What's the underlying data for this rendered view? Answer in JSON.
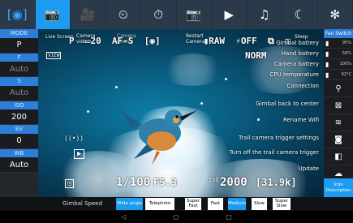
{
  "toolbar": {
    "items": [
      {
        "icon": "brackets-icon",
        "glyph": "[◉]"
      },
      {
        "icon": "camera-icon",
        "glyph": "📷"
      },
      {
        "icon": "video-icon",
        "glyph": "🎥"
      },
      {
        "icon": "timer-icon",
        "glyph": "⏲"
      },
      {
        "icon": "timelapse-icon",
        "glyph": "⏱"
      },
      {
        "icon": "camera-settings-icon",
        "glyph": "📷"
      },
      {
        "icon": "play-icon",
        "glyph": "▶"
      },
      {
        "icon": "music-icon",
        "glyph": "♫"
      },
      {
        "icon": "moon-icon",
        "glyph": "☾"
      },
      {
        "icon": "fan-icon",
        "glyph": "✻"
      }
    ]
  },
  "left_panel": [
    {
      "label": "MODE",
      "value": "P",
      "dim": false
    },
    {
      "label": "F",
      "value": "Auto",
      "dim": true
    },
    {
      "label": "S",
      "value": "Auto",
      "dim": true
    },
    {
      "label": "ISO",
      "value": "200",
      "dim": false
    },
    {
      "label": "EV",
      "value": "0",
      "dim": false
    },
    {
      "label": "WB",
      "value": "Auto",
      "dim": false
    }
  ],
  "right_panel": {
    "title": "Fan Switch",
    "rows": [
      {
        "icon": "battery-icon",
        "text": "95%"
      },
      {
        "icon": "battery-icon",
        "text": "56%"
      },
      {
        "icon": "camera-battery-icon",
        "text": "100%"
      },
      {
        "icon": "thermometer-icon",
        "text": "92°C"
      }
    ],
    "buttons": [
      {
        "name": "connection-icon",
        "glyph": "⚲"
      },
      {
        "name": "gimbal-center-icon",
        "glyph": "⊠"
      },
      {
        "name": "wifi-icon",
        "glyph": "≋"
      },
      {
        "name": "camera-trigger-icon",
        "glyph": "◙"
      },
      {
        "name": "trail-trigger-icon",
        "glyph": "◧"
      },
      {
        "name": "update-icon",
        "glyph": "☁"
      }
    ],
    "icon_description": "Icon Description"
  },
  "viewfinder": {
    "top_labels": [
      "Live Screen",
      "Camera video",
      "Camera photo",
      "Restart Camera",
      "Sleep"
    ],
    "osd_top": "P  ▭20  AF-S  [◉]        ▮RAW  ⚡OFF  ⧉  ◫",
    "view_badge": "VIEW",
    "norm": "NORM",
    "shutter": "1/100",
    "aperture": "F5.3",
    "iso_label": "ISO",
    "iso_value": "2000",
    "shots": "[31.9k]",
    "menu": [
      "Gimbal battery",
      "Hand battery",
      "Camera battery",
      "CPU temperature",
      "Connection",
      "Gimbal back to center",
      "Rename Wifi",
      "Trail camera trigger settings",
      "Turn off the trail camera trigger",
      "Update"
    ]
  },
  "gimbal_speed": {
    "label": "Gimbal Speed",
    "options": [
      {
        "text": "Wide angle",
        "on": true
      },
      {
        "text": "Telephoto",
        "on": false
      },
      {
        "text": "Super Fast",
        "on": false
      },
      {
        "text": "Fast",
        "on": false
      },
      {
        "text": "Medium",
        "on": true
      },
      {
        "text": "Slow",
        "on": false
      },
      {
        "text": "Super Slow",
        "on": false
      }
    ]
  },
  "nav": {
    "back": "◁",
    "home": "○",
    "recent": "□"
  }
}
